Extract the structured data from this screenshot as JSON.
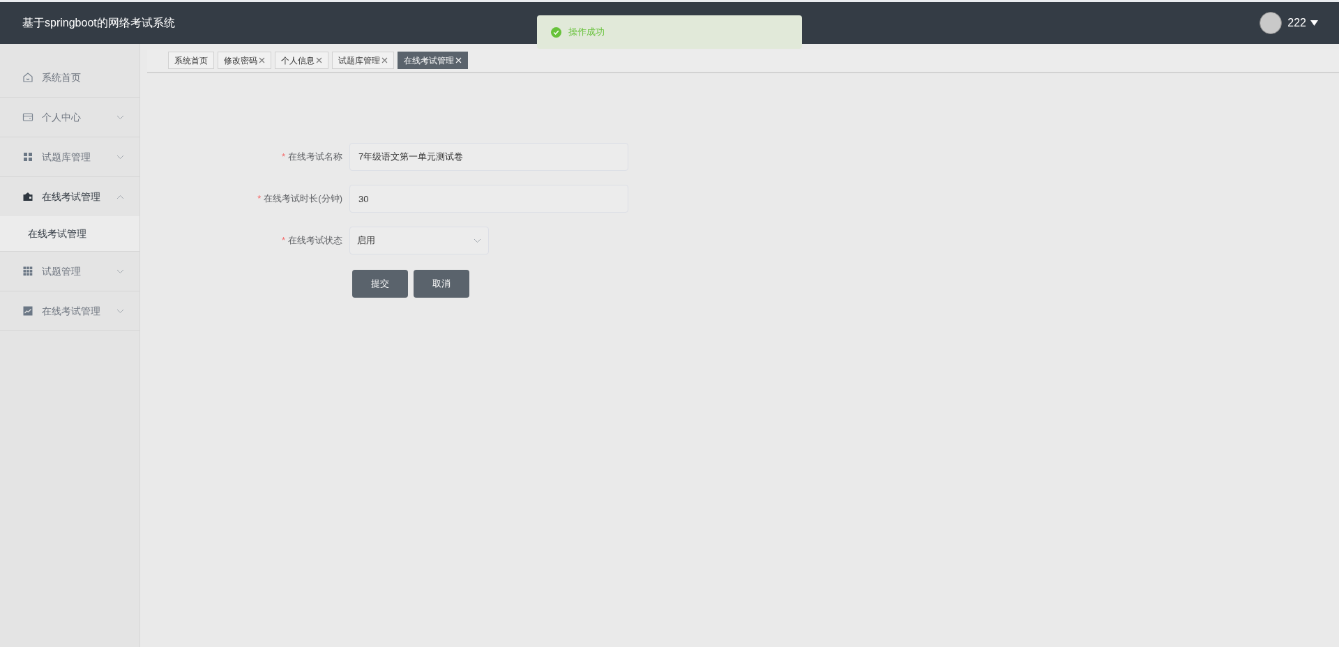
{
  "header": {
    "title": "基于springboot的网络考试系统",
    "user": {
      "name": "222"
    }
  },
  "toast": {
    "kind": "success",
    "message": "操作成功"
  },
  "sidebar": {
    "items": [
      {
        "kind": "link",
        "label": "系统首页"
      },
      {
        "kind": "group",
        "label": "个人中心",
        "expanded": false
      },
      {
        "kind": "group",
        "label": "试题库管理",
        "expanded": false
      },
      {
        "kind": "group",
        "label": "在线考试管理",
        "expanded": true,
        "children": [
          {
            "label": "在线考试管理"
          }
        ]
      },
      {
        "kind": "group",
        "label": "试题管理",
        "expanded": false
      },
      {
        "kind": "group",
        "label": "在线考试管理",
        "expanded": false
      }
    ]
  },
  "tabs": [
    {
      "label": "系统首页",
      "closable": false,
      "selected": false
    },
    {
      "label": "修改密码",
      "closable": true,
      "selected": false
    },
    {
      "label": "个人信息",
      "closable": true,
      "selected": false
    },
    {
      "label": "试题库管理",
      "closable": true,
      "selected": false
    },
    {
      "label": "在线考试管理",
      "closable": true,
      "selected": true
    }
  ],
  "form": {
    "fields": [
      {
        "kind": "text",
        "required_mark": "*",
        "label": "在线考试名称",
        "value": "7年级语文第一单元测试卷"
      },
      {
        "kind": "text",
        "required_mark": "*",
        "label": "在线考试时长(分钟)",
        "value": "30"
      },
      {
        "kind": "select",
        "required_mark": "*",
        "label": "在线考试状态",
        "value": "启用"
      }
    ],
    "buttons": [
      "提交",
      "取消"
    ]
  }
}
